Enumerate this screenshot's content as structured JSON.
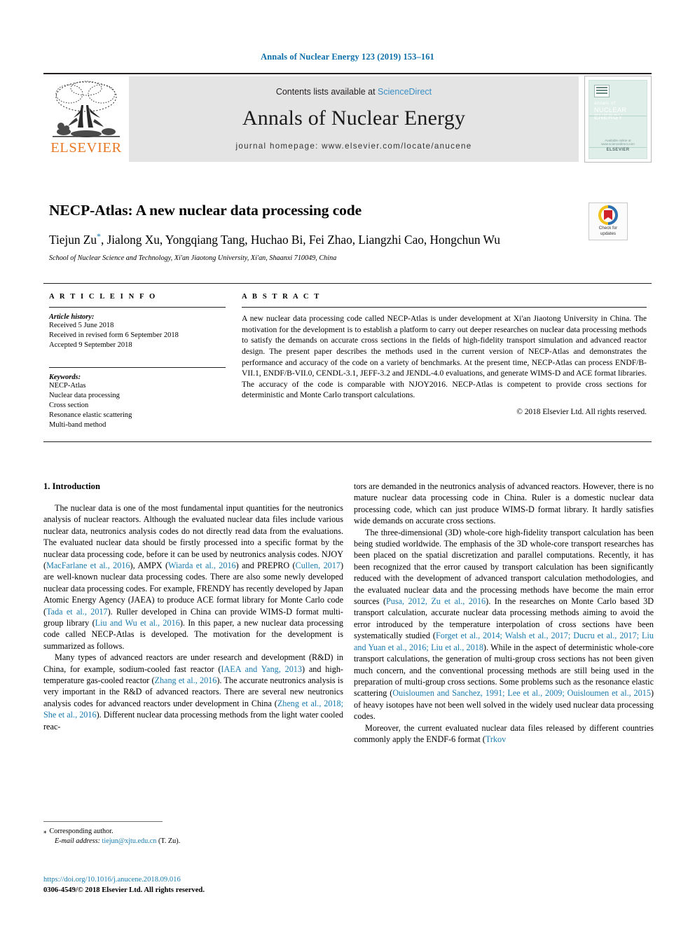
{
  "running_head": "Annals of Nuclear Energy 123 (2019) 153–161",
  "masthead": {
    "publisher": "ELSEVIER",
    "contents_prefix": "Contents lists available at ",
    "contents_link": "ScienceDirect",
    "journal_title": "Annals of Nuclear Energy",
    "homepage": "journal homepage: www.elsevier.com/locate/anucene",
    "cover": {
      "line1": "annals of",
      "line2": "NUCLEAR ENERGY",
      "footer_small": "Available online at www.sciencedirect.com",
      "footer_brand": "ELSEVIER"
    }
  },
  "article": {
    "title": "NECP-Atlas: A new nuclear data processing code",
    "authors": "Tiejun Zu",
    "authors_rest": ", Jialong Xu, Yongqiang Tang, Huchao Bi, Fei Zhao, Liangzhi Cao, Hongchun Wu",
    "corresponding_marker": "*",
    "affiliation": "School of Nuclear Science and Technology, Xi'an Jiaotong University, Xi'an, Shaanxi 710049, China"
  },
  "crossmark": {
    "line1": "Check for",
    "line2": "updates"
  },
  "info": {
    "heading": "A R T I C L E   I N F O",
    "history_label": "Article history:",
    "history": [
      "Received 5 June 2018",
      "Received in revised form 6 September 2018",
      "Accepted 9 September 2018"
    ],
    "keywords_label": "Keywords:",
    "keywords": [
      "NECP-Atlas",
      "Nuclear data processing",
      "Cross section",
      "Resonance elastic scattering",
      "Multi-band method"
    ]
  },
  "abstract": {
    "heading": "A B S T R A C T",
    "text": "A new nuclear data processing code called NECP-Atlas is under development at Xi'an Jiaotong University in China. The motivation for the development is to establish a platform to carry out deeper researches on nuclear data processing methods to satisfy the demands on accurate cross sections in the fields of high-fidelity transport simulation and advanced reactor design. The present paper describes the methods used in the current version of NECP-Atlas and demonstrates the performance and accuracy of the code on a variety of benchmarks. At the present time, NECP-Atlas can process ENDF/B-VII.1, ENDF/B-VII.0, CENDL-3.1, JEFF-3.2 and JENDL-4.0 evaluations, and generate WIMS-D and ACE format libraries. The accuracy of the code is comparable with NJOY2016. NECP-Atlas is competent to provide cross sections for deterministic and Monte Carlo transport calculations.",
    "rights": "© 2018 Elsevier Ltd. All rights reserved."
  },
  "body": {
    "section_title": "1. Introduction",
    "left": [
      "The nuclear data is one of the most fundamental input quantities for the neutronics analysis of nuclear reactors. Although the evaluated nuclear data files include various nuclear data, neutronics analysis codes do not directly read data from the evaluations. The evaluated nuclear data should be firstly processed into a specific format by the nuclear data processing code, before it can be used by neutronics analysis codes. NJOY (MacFarlane et al., 2016), AMPX (Wiarda et al., 2016) and PREPRO (Cullen, 2017) are well-known nuclear data processing codes. There are also some newly developed nuclear data processing codes. For example, FRENDY has recently developed by Japan Atomic Energy Agency (JAEA) to produce ACE format library for Monte Carlo code (Tada et al., 2017). Ruller developed in China can provide WIMS-D format multi-group library (Liu and Wu et al., 2016). In this paper, a new nuclear data processing code called NECP-Atlas is developed. The motivation for the development is summarized as follows.",
      "Many types of advanced reactors are under research and development (R&D) in China, for example, sodium-cooled fast reactor (IAEA and Yang, 2013) and high-temperature gas-cooled reactor (Zhang et al., 2016). The accurate neutronics analysis is very important in the R&D of advanced reactors. There are several new neutronics analysis codes for advanced reactors under development in China (Zheng et al., 2018; She et al., 2016). Different nuclear data processing methods from the light water cooled reac-"
    ],
    "right": [
      "tors are demanded in the neutronics analysis of advanced reactors. However, there is no mature nuclear data processing code in China. Ruler is a domestic nuclear data processing code, which can just produce WIMS-D format library. It hardly satisfies wide demands on accurate cross sections.",
      "The three-dimensional (3D) whole-core high-fidelity transport calculation has been being studied worldwide. The emphasis of the 3D whole-core transport researches has been placed on the spatial discretization and parallel computations. Recently, it has been recognized that the error caused by transport calculation has been significantly reduced with the development of advanced transport calculation methodologies, and the evaluated nuclear data and the processing methods have become the main error sources (Pusa, 2012, Zu et al., 2016). In the researches on Monte Carlo based 3D transport calculation, accurate nuclear data processing methods aiming to avoid the error introduced by the temperature interpolation of cross sections have been systematically studied (Forget et al., 2014; Walsh et al., 2017; Ducru et al., 2017; Liu and Yuan et al., 2016; Liu et al., 2018). While in the aspect of deterministic whole-core transport calculations, the generation of multi-group cross sections has not been given much concern, and the conventional processing methods are still being used in the preparation of multi-group cross sections. Some problems such as the resonance elastic scattering (Ouisloumen and Sanchez, 1991; Lee et al., 2009; Ouisloumen et al., 2015) of heavy isotopes have not been well solved in the widely used nuclear data processing codes.",
      "Moreover, the current evaluated nuclear data files released by different countries commonly apply the ENDF-6 format (Trkov"
    ],
    "citations": [
      "MacFarlane et al., 2016",
      "Wiarda et al., 2016",
      "Cullen, 2017",
      "Tada et al., 2017",
      "Liu and Wu et al., 2016",
      "IAEA and Yang, 2013",
      "Zhang et al., 2016",
      "Zheng et al., 2018; She et al., 2016",
      "Pusa, 2012, Zu et al., 2016",
      "Forget et al., 2014; Walsh et al., 2017; Ducru et al., 2017; Liu and Yuan et al., 2016; Liu et al., 2018",
      "Ouisloumen and Sanchez, 1991; Lee et al., 2009; Ouisloumen et al., 2015",
      "Trkov"
    ]
  },
  "footnote": {
    "corresponding": "Corresponding author.",
    "email_label": "E-mail address:",
    "email": "tiejun@xjtu.edu.cn",
    "email_suffix": "(T. Zu)."
  },
  "footer": {
    "doi": "https://doi.org/10.1016/j.anucene.2018.09.016",
    "issn_rights": "0306-4549/© 2018 Elsevier Ltd. All rights reserved."
  },
  "colors": {
    "link_blue": "#1a7aac",
    "head_blue": "#0b6ea8",
    "elsevier_orange": "#e87722",
    "band_gray": "#e4e4e4"
  }
}
